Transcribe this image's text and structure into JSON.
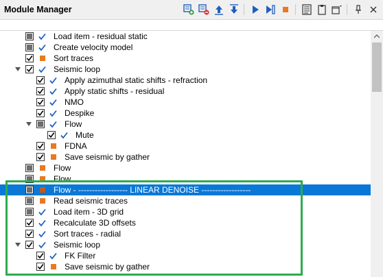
{
  "window": {
    "title": "Module Manager"
  },
  "toolbar": {
    "buttons": [
      {
        "icon": "add-module-icon",
        "color": "#1f5fbf"
      },
      {
        "icon": "remove-module-icon",
        "color": "#1f5fbf"
      },
      {
        "icon": "move-up-icon",
        "color": "#1f5fbf"
      },
      {
        "icon": "move-down-icon",
        "color": "#1f5fbf"
      },
      {
        "icon": "run-icon",
        "color": "#1f5fbf"
      },
      {
        "icon": "run-step-icon",
        "color": "#1f5fbf"
      },
      {
        "icon": "stop-icon",
        "color": "#e87a22"
      },
      {
        "icon": "properties-icon",
        "color": "#333333"
      },
      {
        "icon": "clipboard-icon",
        "color": "#333333"
      },
      {
        "icon": "window-options-icon",
        "color": "#333333"
      },
      {
        "icon": "pin-icon",
        "color": "#333333"
      },
      {
        "icon": "close-icon",
        "color": "#333333"
      }
    ]
  },
  "colors": {
    "selection": "#0a78d7",
    "check": "#1f5fbf",
    "status_orange": "#e87a22",
    "highlight_border": "#2daa4d"
  },
  "tree": {
    "rows": [
      {
        "label": "Load item - residual static",
        "depth": 0,
        "checkbox": "partial",
        "status": "check",
        "expander": "none"
      },
      {
        "label": "Create velocity model",
        "depth": 0,
        "checkbox": "partial",
        "status": "check",
        "expander": "none"
      },
      {
        "label": "Sort traces",
        "depth": 0,
        "checkbox": "checked",
        "status": "square",
        "expander": "none"
      },
      {
        "label": "Seismic loop",
        "depth": 0,
        "checkbox": "checked",
        "status": "check",
        "expander": "open"
      },
      {
        "label": "Apply azimuthal static shifts - refraction",
        "depth": 1,
        "checkbox": "checked",
        "status": "check",
        "expander": "none"
      },
      {
        "label": "Apply static shifts - residual",
        "depth": 1,
        "checkbox": "checked",
        "status": "check",
        "expander": "none"
      },
      {
        "label": "NMO",
        "depth": 1,
        "checkbox": "checked",
        "status": "check",
        "expander": "none"
      },
      {
        "label": "Despike",
        "depth": 1,
        "checkbox": "checked",
        "status": "check",
        "expander": "none"
      },
      {
        "label": "Flow",
        "depth": 1,
        "checkbox": "partial",
        "status": "check",
        "expander": "open"
      },
      {
        "label": "Mute",
        "depth": 2,
        "checkbox": "checked",
        "status": "check",
        "expander": "none"
      },
      {
        "label": "FDNA",
        "depth": 1,
        "checkbox": "checked",
        "status": "square",
        "expander": "none"
      },
      {
        "label": "Save seismic by gather",
        "depth": 1,
        "checkbox": "checked",
        "status": "square",
        "expander": "none"
      },
      {
        "label": "Flow",
        "depth": 0,
        "checkbox": "partial",
        "status": "square",
        "expander": "none"
      },
      {
        "label": "Flow",
        "depth": 0,
        "checkbox": "partial",
        "status": "square",
        "expander": "none"
      },
      {
        "label": "Flow - ------------------ LINEAR DENOISE ------------------",
        "depth": 0,
        "checkbox": "partial",
        "status": "square",
        "expander": "none",
        "selected": true
      },
      {
        "label": "Read seismic traces",
        "depth": 0,
        "checkbox": "partial",
        "status": "square",
        "expander": "none"
      },
      {
        "label": "Load item - 3D grid",
        "depth": 0,
        "checkbox": "partial",
        "status": "check",
        "expander": "none"
      },
      {
        "label": "Recalculate 3D offsets",
        "depth": 0,
        "checkbox": "checked",
        "status": "check",
        "expander": "none"
      },
      {
        "label": "Sort traces - radial",
        "depth": 0,
        "checkbox": "checked",
        "status": "check",
        "expander": "none"
      },
      {
        "label": "Seismic loop",
        "depth": 0,
        "checkbox": "checked",
        "status": "check",
        "expander": "open"
      },
      {
        "label": "FK Filter",
        "depth": 1,
        "checkbox": "checked",
        "status": "check",
        "expander": "none"
      },
      {
        "label": "Save seismic by gather",
        "depth": 1,
        "checkbox": "checked",
        "status": "square",
        "expander": "none"
      }
    ]
  }
}
